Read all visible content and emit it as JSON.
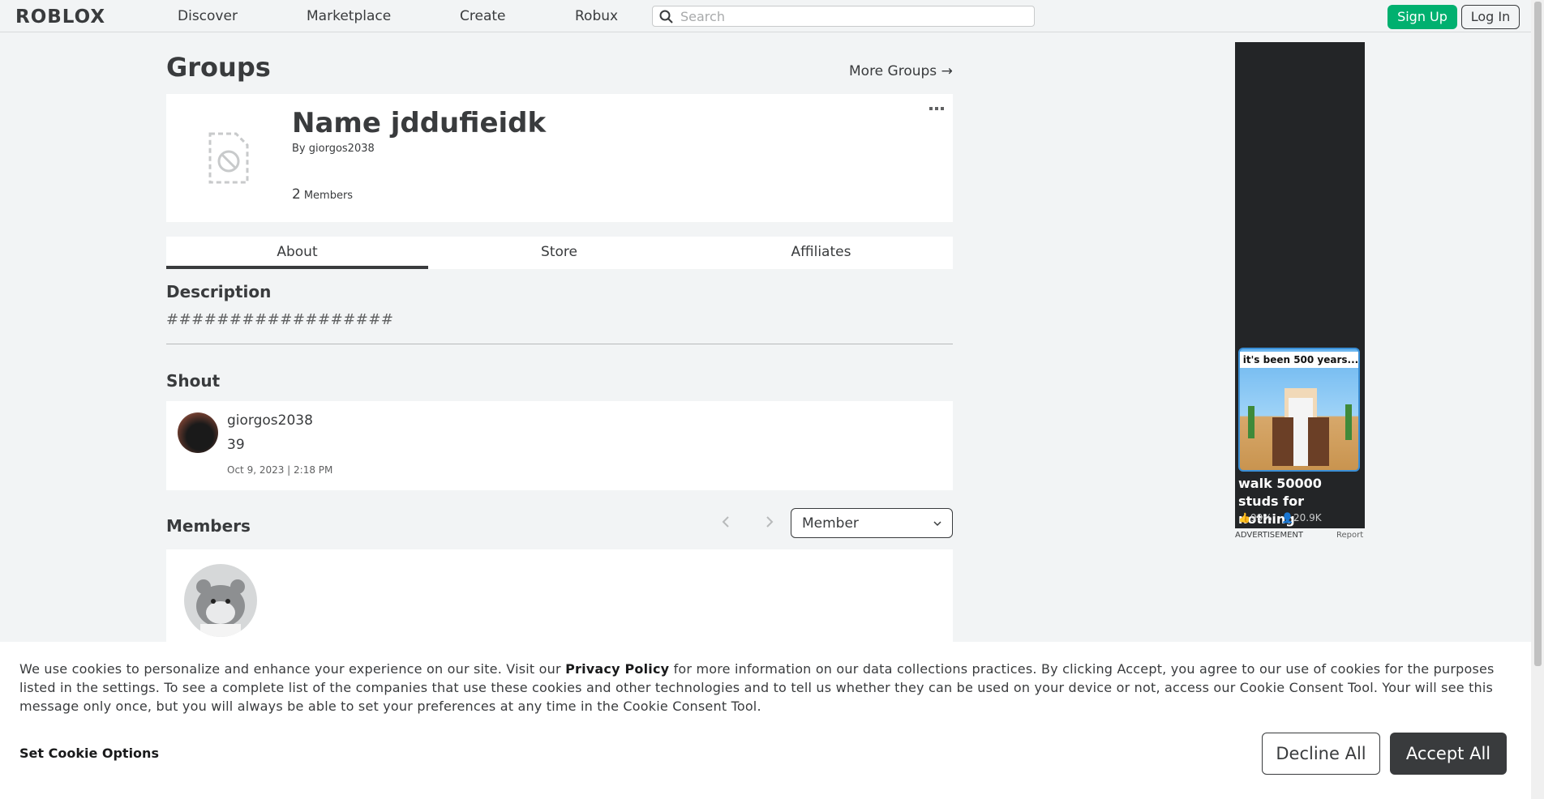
{
  "header": {
    "logo": "ROBLOX",
    "nav": [
      "Discover",
      "Marketplace",
      "Create",
      "Robux"
    ],
    "search_placeholder": "Search",
    "signup_label": "Sign Up",
    "login_label": "Log In"
  },
  "page": {
    "title": "Groups",
    "more_groups_label": "More Groups →"
  },
  "group": {
    "name": "Name jddufieidk",
    "by_prefix": "By",
    "owner": "giorgos2038",
    "member_count": "2",
    "members_label": "Members"
  },
  "tabs": [
    "About",
    "Store",
    "Affiliates"
  ],
  "active_tab": "About",
  "description": {
    "heading": "Description",
    "text": "##################"
  },
  "shout": {
    "heading": "Shout",
    "user": "giorgos2038",
    "body": "39",
    "date": "Oct 9, 2023 | 2:18 PM"
  },
  "members": {
    "heading": "Members",
    "role_filter": "Member"
  },
  "ad": {
    "thumb_caption": "it's been 500 years...",
    "title": "walk 50000 studs for nothing",
    "rating": "99%",
    "players": "20.9K",
    "footer_left": "ADVERTISEMENT",
    "footer_right": "Report"
  },
  "cookie": {
    "text_before": "We use cookies to personalize and enhance your experience on our site. Visit our ",
    "privacy_link": "Privacy Policy",
    "text_after": " for more information on our data collections practices. By clicking Accept, you agree to our use of cookies for the purposes listed in the settings. To see a complete list of the companies that use these cookies and other technologies and to tell us whether they can be used on your device or not, access our Cookie Consent Tool. Your will see this message only once, but you will always be able to set your preferences at any time in the Cookie Consent Tool.",
    "options_label": "Set Cookie Options",
    "decline_label": "Decline All",
    "accept_label": "Accept All"
  },
  "colors": {
    "accent_green": "#00b06f",
    "text_dark": "#393b3d",
    "background": "#f2f4f5"
  }
}
